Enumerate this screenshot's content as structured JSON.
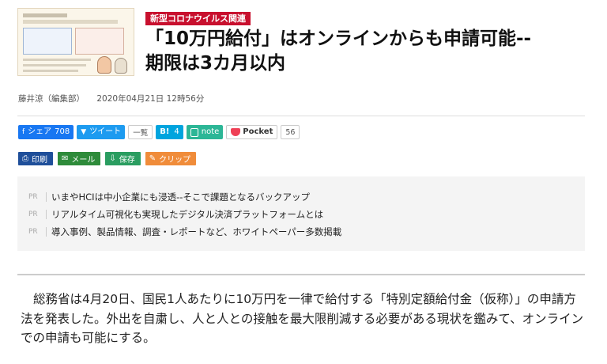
{
  "category_tag": "新型コロナウイルス関連",
  "title_line1": "「10万円給付」はオンラインからも申請可能--",
  "title_line2": "期限は3カ月以内",
  "author": "藤井涼（編集部）",
  "date": "2020年04月21日 12時56分",
  "share": {
    "facebook_label": "シェア",
    "facebook_count": "708",
    "tweet_label": "ツイート",
    "tweet_list_label": "一覧",
    "hatena_label": "B!",
    "hatena_count": "4",
    "note_label": "note",
    "pocket_label": "Pocket",
    "pocket_count": "56"
  },
  "tools": {
    "print": "印刷",
    "mail": "メール",
    "save": "保存",
    "clip": "クリップ"
  },
  "pr": {
    "label": "PR",
    "items": [
      "いまやHCIは中小企業にも浸透--そこで課題となるバックアップ",
      "リアルタイム可視化も実現したデジタル決済プラットフォームとは",
      "導入事例、製品情報、調査・レポートなど、ホワイトペーパー多数掲載"
    ]
  },
  "body": "総務省は4月20日、国民1人あたりに10万円を一律で給付する「特別定額給付金（仮称）」の申請方法を発表した。外出を自粛し、人と人との接触を最大限削減する必要がある現状を鑑みて、オンラインでの申請も可能にする。",
  "colors": {
    "tag": "#c8102e",
    "facebook": "#1877f2",
    "twitter": "#1d9bf0",
    "hatena": "#00a4de",
    "note": "#2cb696",
    "pocket": "#ef4056",
    "print": "#1f4f9a",
    "mail": "#2e8b3a",
    "save": "#2a9d60",
    "clip": "#f08c3a"
  }
}
